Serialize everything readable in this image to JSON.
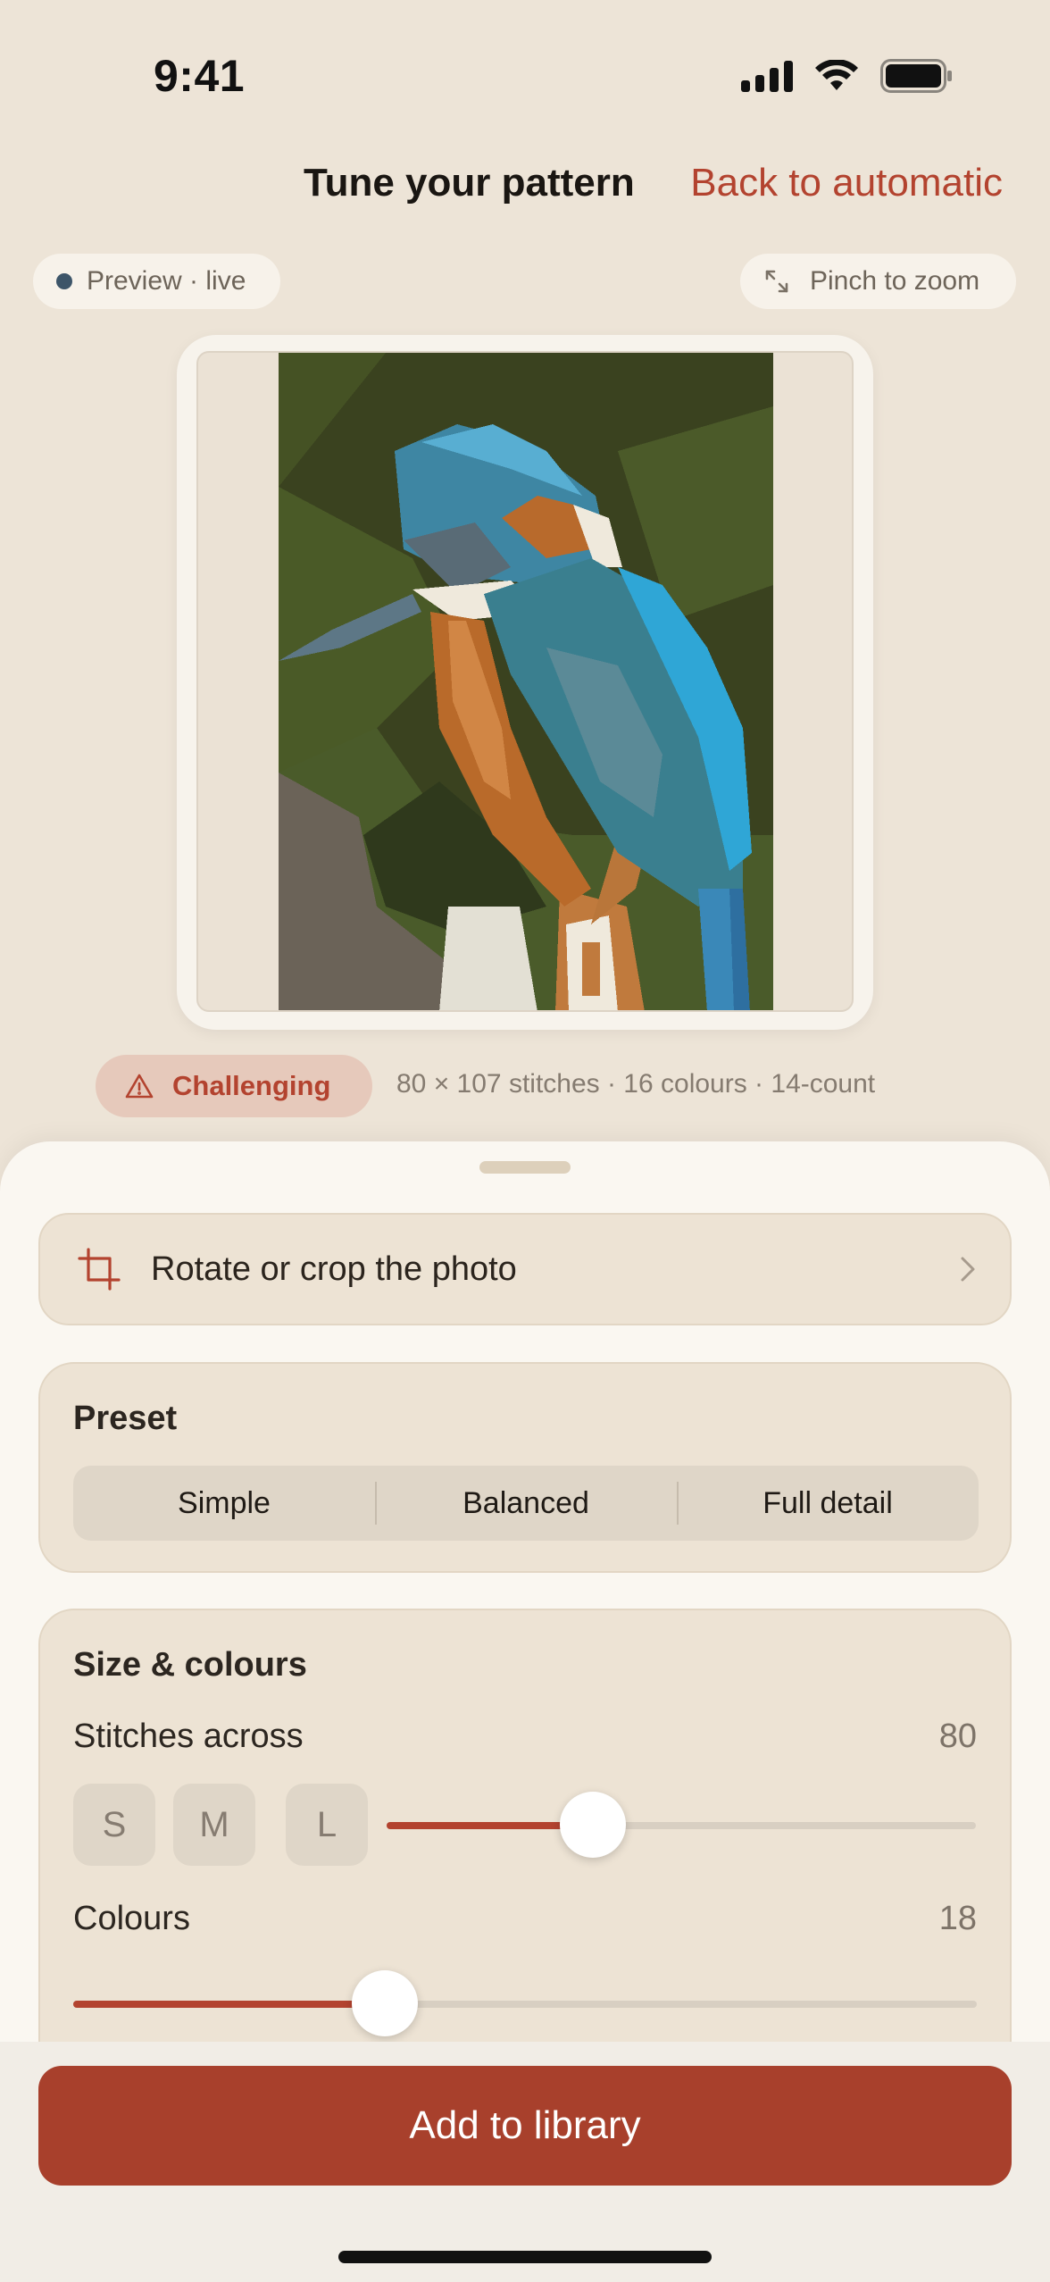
{
  "status_bar": {
    "time": "9:41"
  },
  "header": {
    "title": "Tune your pattern",
    "back_label": "Back to automatic"
  },
  "preview_pill": {
    "label": "Preview · live",
    "status_color": "#3d5569"
  },
  "zoom_pill": {
    "label": "Pinch to zoom",
    "icon": "expand-icon"
  },
  "pattern_summary": {
    "difficulty": "Challenging",
    "stats": "80 × 107 stitches · 16 colours · 14-count"
  },
  "crop": {
    "label": "Rotate or crop the photo",
    "icon": "crop-icon"
  },
  "preset": {
    "title": "Preset",
    "options": [
      "Simple",
      "Balanced",
      "Full detail"
    ]
  },
  "size_colours": {
    "title": "Size & colours",
    "stitches_label": "Stitches across",
    "stitches_value": "80",
    "stitches_slider_fraction": 0.35,
    "size_options": [
      "S",
      "M",
      "L"
    ],
    "colours_label": "Colours",
    "colours_value": "18",
    "colours_slider_fraction": 0.345
  },
  "actions": {
    "primary_label": "Add to library"
  },
  "colors": {
    "accent": "#b3432f",
    "button": "#a8402c",
    "background": "#ede4d7"
  }
}
